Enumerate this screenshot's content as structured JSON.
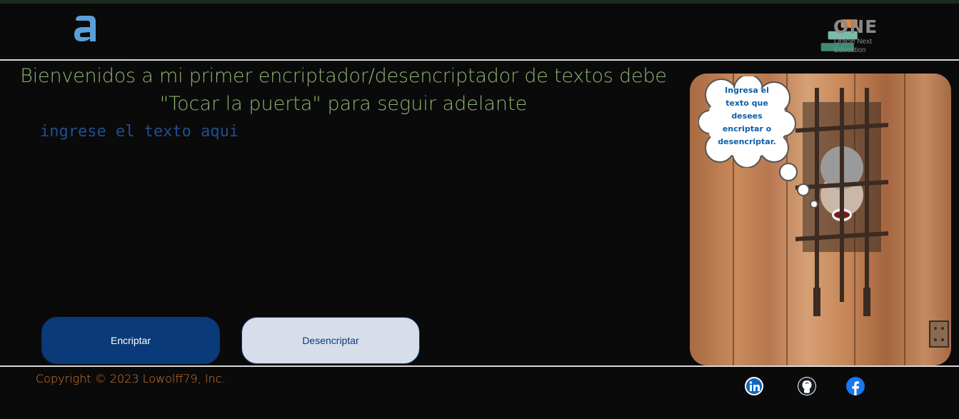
{
  "header": {
    "left_logo_icon": "alura-a-logo-icon",
    "right_logo_icon": "oracle-one-logo-icon",
    "right_logo_title": "ONE",
    "right_logo_sub1": "Oracle Next",
    "right_logo_sub2": "Education"
  },
  "main": {
    "title_line1": "Bienvenidos a mi primer encriptador/desencriptador de textos debe",
    "title_line2": "\"Tocar la puerta\" para seguir adelante",
    "input_placeholder": "ingrese el texto aqui",
    "encrypt_label": "Encriptar",
    "decrypt_label": "Desencriptar"
  },
  "side": {
    "bubble_lines": [
      "Ingresa el",
      "texto que",
      "desees",
      "encriptar o",
      "desencriptar."
    ]
  },
  "footer": {
    "copyright": "Copyright © 2023 Lowolff79, Inc.",
    "social_icons": [
      "linkedin-icon",
      "github-icon",
      "facebook-icon"
    ]
  },
  "colors": {
    "background": "#0a0a0a",
    "title": "#8fb26f",
    "accent_blue": "#0a3a78",
    "light_button": "#d7deea",
    "copyright": "#d87a30",
    "bubble_text": "#0b5fa8"
  }
}
